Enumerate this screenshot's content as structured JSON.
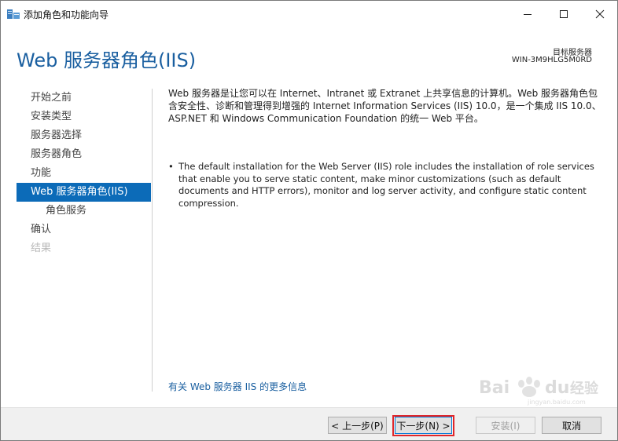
{
  "window": {
    "title": "添加角色和功能向导",
    "min_glyph": "—",
    "max_glyph": "☐",
    "close_glyph": "✕"
  },
  "header": {
    "title": "Web 服务器角色(IIS)",
    "dest_label": "目标服务器",
    "dest_server": "WIN-3M9HLG5M0RD"
  },
  "nav": {
    "items": [
      {
        "label": "开始之前",
        "state": "normal"
      },
      {
        "label": "安装类型",
        "state": "normal"
      },
      {
        "label": "服务器选择",
        "state": "normal"
      },
      {
        "label": "服务器角色",
        "state": "normal"
      },
      {
        "label": "功能",
        "state": "normal"
      },
      {
        "label": "Web 服务器角色(IIS)",
        "state": "active"
      },
      {
        "label": "角色服务",
        "state": "sub"
      },
      {
        "label": "确认",
        "state": "normal"
      },
      {
        "label": "结果",
        "state": "disabled"
      }
    ]
  },
  "content": {
    "description": "Web 服务器是让您可以在 Internet、Intranet 或 Extranet 上共享信息的计算机。Web 服务器角色包含安全性、诊断和管理得到增强的 Internet Information Services (IIS) 10.0，是一个集成 IIS 10.0、ASP.NET 和 Windows Communication Foundation 的统一 Web 平台。",
    "bullet_glyph": "•",
    "bullet": "The default installation for the Web Server (IIS) role includes the installation of role services that enable you to serve static content, make minor customizations (such as default documents and HTTP errors), monitor and log server activity, and configure static content compression.",
    "more_link": "有关 Web 服务器 IIS 的更多信息"
  },
  "footer": {
    "prev": "< 上一步(P)",
    "next": "下一步(N) >",
    "install": "安装(I)",
    "cancel": "取消"
  },
  "colors": {
    "accent": "#0c6bb8",
    "title_blue": "#1a5fa0",
    "highlight_red": "#e0262a"
  },
  "watermark": {
    "text": "Bai du 经验",
    "subtext": "jingyan.baidu.com"
  }
}
